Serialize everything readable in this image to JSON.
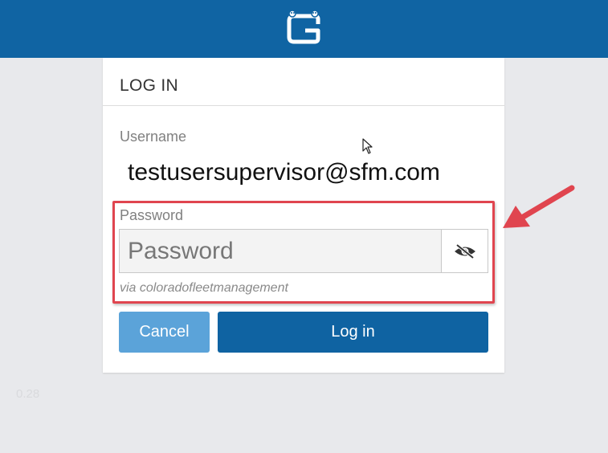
{
  "header": {
    "logo_icon": "g-logo-icon",
    "bg_color": "#1064a3"
  },
  "login": {
    "title": "LOG IN",
    "username_label": "Username",
    "username_value": "testusersupervisor@sfm.com",
    "password_label": "Password",
    "password_placeholder": "Password",
    "password_toggle_icon": "eye-slash-icon",
    "via_text": "via coloradofleetmanagement",
    "cancel_label": "Cancel",
    "login_label": "Log in"
  },
  "annotation": {
    "color": "#e0454f"
  },
  "footer": {
    "version": "0.28"
  }
}
